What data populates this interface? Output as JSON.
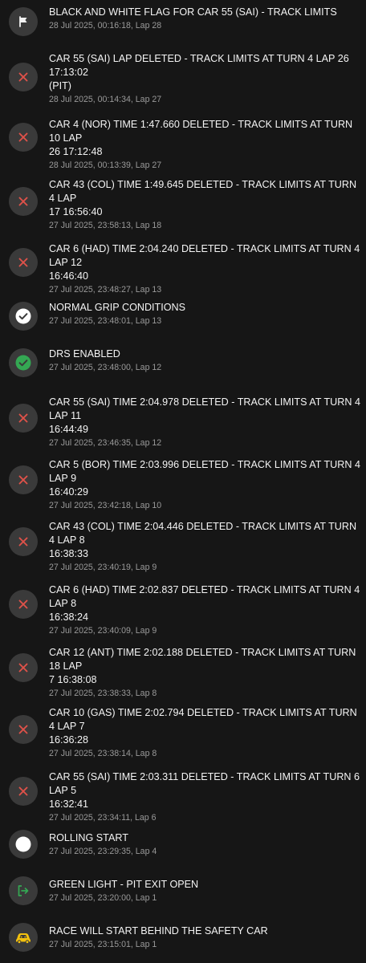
{
  "feed": {
    "items": [
      {
        "icon": "flag-icon",
        "message": "BLACK AND WHITE FLAG FOR CAR 55 (SAI) - TRACK LIMITS",
        "meta": "28 Jul 2025, 00:16:18, Lap 28"
      },
      {
        "icon": "x-icon",
        "message": "CAR 55 (SAI) LAP DELETED - TRACK LIMITS AT TURN 4 LAP 26 17:13:02\n(PIT)",
        "meta": "28 Jul 2025, 00:14:34, Lap 27"
      },
      {
        "icon": "x-icon",
        "message": "CAR 4 (NOR) TIME 1:47.660 DELETED - TRACK LIMITS AT TURN 10 LAP\n26 17:12:48",
        "meta": "28 Jul 2025, 00:13:39, Lap 27"
      },
      {
        "icon": "x-icon",
        "message": "CAR 43 (COL) TIME 1:49.645 DELETED - TRACK LIMITS AT TURN 4 LAP\n17 16:56:40",
        "meta": "27 Jul 2025, 23:58:13, Lap 18"
      },
      {
        "icon": "x-icon",
        "message": "CAR 6 (HAD) TIME 2:04.240 DELETED - TRACK LIMITS AT TURN 4 LAP 12\n16:46:40",
        "meta": "27 Jul 2025, 23:48:27, Lap 13"
      },
      {
        "icon": "check-circle-icon",
        "message": "NORMAL GRIP CONDITIONS",
        "meta": "27 Jul 2025, 23:48:01, Lap 13"
      },
      {
        "icon": "check-circle-green-icon",
        "message": "DRS ENABLED",
        "meta": "27 Jul 2025, 23:48:00, Lap 12"
      },
      {
        "icon": "x-icon",
        "message": "CAR 55 (SAI) TIME 2:04.978 DELETED - TRACK LIMITS AT TURN 4 LAP 11\n16:44:49",
        "meta": "27 Jul 2025, 23:46:35, Lap 12"
      },
      {
        "icon": "x-icon",
        "message": "CAR 5 (BOR) TIME 2:03.996 DELETED - TRACK LIMITS AT TURN 4 LAP 9\n16:40:29",
        "meta": "27 Jul 2025, 23:42:18, Lap 10"
      },
      {
        "icon": "x-icon",
        "message": "CAR 43 (COL) TIME 2:04.446 DELETED - TRACK LIMITS AT TURN 4 LAP 8\n16:38:33",
        "meta": "27 Jul 2025, 23:40:19, Lap 9"
      },
      {
        "icon": "x-icon",
        "message": "CAR 6 (HAD) TIME 2:02.837 DELETED - TRACK LIMITS AT TURN 4 LAP 8\n16:38:24",
        "meta": "27 Jul 2025, 23:40:09, Lap 9"
      },
      {
        "icon": "x-icon",
        "message": "CAR 12 (ANT) TIME 2:02.188 DELETED - TRACK LIMITS AT TURN 18 LAP\n7 16:38:08",
        "meta": "27 Jul 2025, 23:38:33, Lap 8"
      },
      {
        "icon": "x-icon",
        "message": "CAR 10 (GAS) TIME 2:02.794 DELETED - TRACK LIMITS AT TURN 4 LAP 7\n16:36:28",
        "meta": "27 Jul 2025, 23:38:14, Lap 8"
      },
      {
        "icon": "x-icon",
        "message": "CAR 55 (SAI) TIME 2:03.311 DELETED - TRACK LIMITS AT TURN 6 LAP 5\n16:32:41",
        "meta": "27 Jul 2025, 23:34:11, Lap 6"
      },
      {
        "icon": "circle-icon",
        "message": "ROLLING START",
        "meta": "27 Jul 2025, 23:29:35, Lap 4"
      },
      {
        "icon": "pit-exit-icon",
        "message": "GREEN LIGHT - PIT EXIT OPEN",
        "meta": "27 Jul 2025, 23:20:00, Lap 1"
      },
      {
        "icon": "safety-car-icon",
        "message": "RACE WILL START BEHIND THE SAFETY CAR",
        "meta": "27 Jul 2025, 23:15:01, Lap 1"
      }
    ]
  },
  "colors": {
    "background": "#161616",
    "icon_bg": "#3a3a3a",
    "delete_red": "#e0524a",
    "green": "#34a853",
    "safety_yellow": "#f4c20d",
    "meta_text": "#9a9a9a"
  }
}
